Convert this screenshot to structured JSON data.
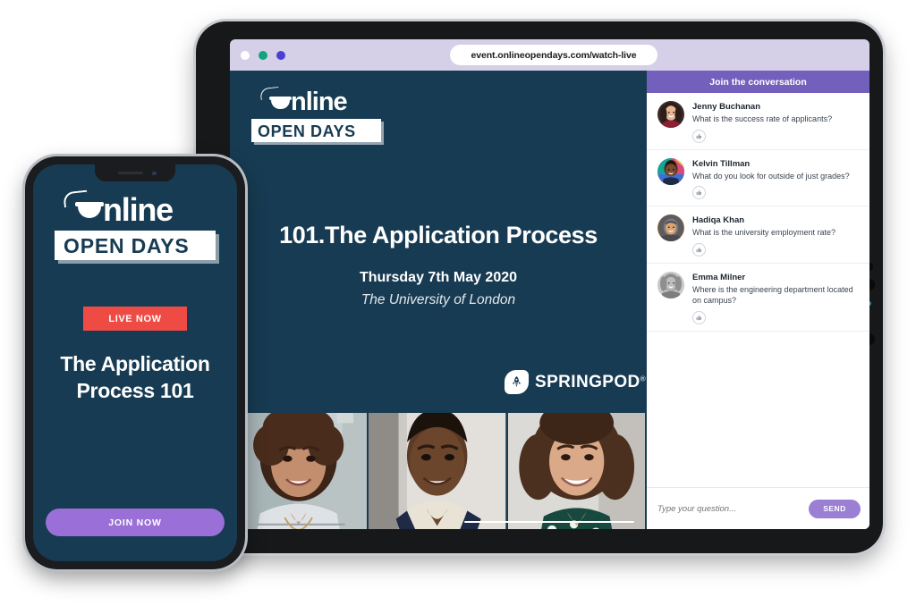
{
  "browser": {
    "url": "event.onlineopendays.com/watch-live",
    "dots": [
      "white-dot",
      "green-dot",
      "blue-dot"
    ]
  },
  "brand": {
    "logo_word_top": "nline",
    "logo_word_bottom": "OPEN DAYS",
    "sponsor_name": "SPRINGPOD",
    "sponsor_reg": "®"
  },
  "slide": {
    "title": "101.The Application Process",
    "date": "Thursday 7th May 2020",
    "institution": "The University of London"
  },
  "chat": {
    "header": "Join the conversation",
    "messages": [
      {
        "name": "Jenny Buchanan",
        "text": "What is the success rate of applicants?"
      },
      {
        "name": "Kelvin Tillman",
        "text": "What do you look for outside of just grades?"
      },
      {
        "name": "Hadiqa Khan",
        "text": "What is the university employment rate?"
      },
      {
        "name": "Emma Milner",
        "text": "Where is the engineering department located on campus?"
      }
    ],
    "input_placeholder": "Type your question...",
    "send_label": "SEND"
  },
  "phone": {
    "live_badge": "LIVE NOW",
    "title": "The Application Process 101",
    "join_label": "JOIN NOW"
  },
  "colors": {
    "navy": "#173b52",
    "purple": "#7360bc",
    "purple_light": "#9b7fd4",
    "join_purple": "#9b6fd8",
    "red": "#ee4b45",
    "chrome": "#d5d0e8"
  }
}
